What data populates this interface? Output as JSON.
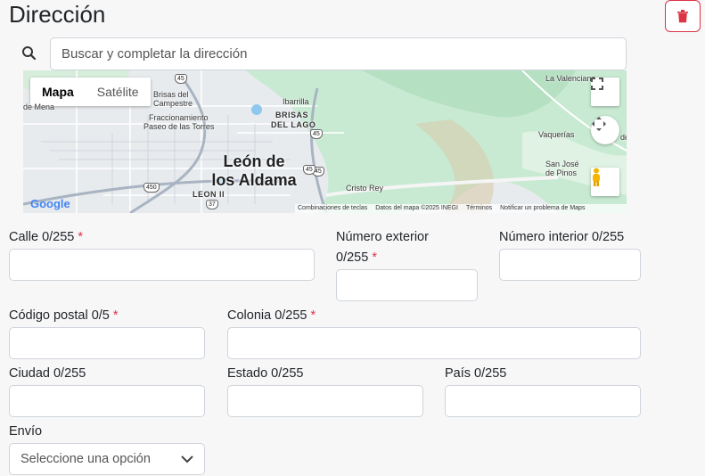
{
  "section": {
    "title": "Dirección"
  },
  "search": {
    "placeholder": "Buscar y completar la dirección"
  },
  "map": {
    "type_tabs": [
      "Mapa",
      "Satélite"
    ],
    "city_label": [
      "León de",
      "los Aldama"
    ],
    "places": [
      "La Valenciana",
      "Ibarrilla",
      "Brisas del Campestre",
      "BRISAS",
      "DEL LAGO",
      "Fraccionamiento",
      "Paseo de las Torres",
      "de Mena",
      "Vaquerías",
      "San José",
      "de Pinos",
      "Cristo Rey",
      "LEON II"
    ],
    "roads": [
      "45",
      "45",
      "45",
      "45",
      "450",
      "37"
    ],
    "edge_glyph": "de",
    "logo": "Google",
    "footer": [
      "Combinaciones de teclas",
      "Datos del mapa ©2025 INEGI",
      "Términos",
      "Notificar un problema de Maps"
    ]
  },
  "form": {
    "calle": "Calle 0/255",
    "num_ext_1": "Número exterior",
    "num_ext_2": "0/255",
    "num_int": "Número interior 0/255",
    "cp": "Código postal 0/5",
    "colonia": "Colonia 0/255",
    "ciudad": "Ciudad 0/255",
    "estado": "Estado 0/255",
    "pais": "País 0/255",
    "envio": "Envío",
    "envio_placeholder": "Seleccione una opción",
    "required_mark": "*"
  },
  "colors": {
    "danger": "#dc3545",
    "border": "#ced4da",
    "map_green": "#b7e4c7"
  }
}
